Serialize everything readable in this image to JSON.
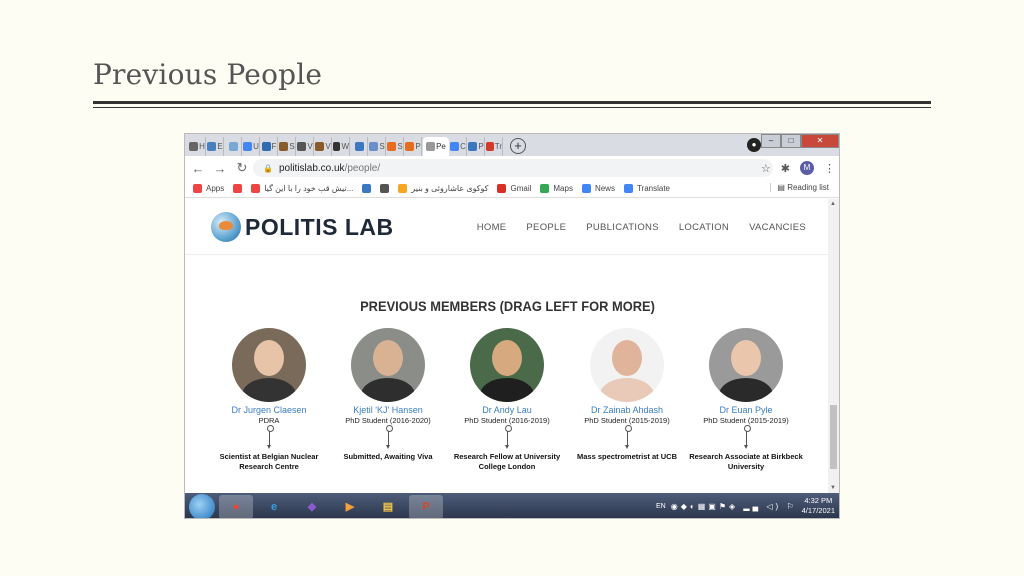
{
  "slide": {
    "title": "Previous People"
  },
  "browser": {
    "tabs": [
      {
        "label": "H",
        "color": "#666"
      },
      {
        "label": "E",
        "color": "#4a7fbf"
      },
      {
        "label": "",
        "color": "#7aa7d6"
      },
      {
        "label": "U",
        "color": "#4285f4"
      },
      {
        "label": "F",
        "color": "#2d6bb3"
      },
      {
        "label": "S",
        "color": "#8a5a2b"
      },
      {
        "label": "V",
        "color": "#555"
      },
      {
        "label": "V",
        "color": "#8a5a2b"
      },
      {
        "label": "W",
        "color": "#333"
      },
      {
        "label": "",
        "color": "#3b78c2"
      },
      {
        "label": "S",
        "color": "#6a8fc9"
      },
      {
        "label": "S",
        "color": "#e66c1f"
      },
      {
        "label": "P",
        "color": "#e66c1f"
      },
      {
        "label": "Pe",
        "color": "#999",
        "active": true
      },
      {
        "label": "C",
        "color": "#4285f4"
      },
      {
        "label": "P",
        "color": "#3b78c2"
      },
      {
        "label": "Tr",
        "color": "#d23a2a"
      }
    ],
    "new_tab": "+",
    "window_controls": {
      "minimize": "–",
      "maximize": "□",
      "close": "✕"
    },
    "url_host": "politislab.co.uk",
    "url_path": "/people/",
    "profile_initial": "M",
    "bookmarks": [
      {
        "label": "Apps",
        "color": "#e44"
      },
      {
        "label": "",
        "color": "#e44"
      },
      {
        "label": "تیش قب خود را با این گیا...",
        "color": "#e44"
      },
      {
        "label": "",
        "color": "#3b78c2"
      },
      {
        "label": "",
        "color": "#555"
      },
      {
        "label": "کوکوی عاشاروئی و بنیر",
        "color": "#f5a623"
      },
      {
        "label": "Gmail",
        "color": "#d93025"
      },
      {
        "label": "Maps",
        "color": "#34a853"
      },
      {
        "label": "News",
        "color": "#4285f4"
      },
      {
        "label": "Translate",
        "color": "#4285f4"
      }
    ],
    "reading_list": "Reading list"
  },
  "site": {
    "logo": "POLITIS LAB",
    "nav": [
      "HOME",
      "PEOPLE",
      "PUBLICATIONS",
      "LOCATION",
      "VACANCIES"
    ],
    "section_title": "PREVIOUS MEMBERS (DRAG LEFT FOR MORE)",
    "people": [
      {
        "name": "Dr Jurgen Claesen",
        "role": "PDRA",
        "destination": "Scientist at Belgian Nuclear Research Centre",
        "bg": "#7a6a5a",
        "skin": "#e7c4a8",
        "shirt": "#333"
      },
      {
        "name": "Kjetil 'KJ' Hansen",
        "role": "PhD Student (2016-2020)",
        "destination": "Submitted, Awaiting Viva",
        "bg": "#8a8d88",
        "skin": "#d9b293",
        "shirt": "#2e2e2e"
      },
      {
        "name": "Dr Andy Lau",
        "role": "PhD Student (2016-2019)",
        "destination": "Research Fellow at University College London",
        "bg": "#4a6a4a",
        "skin": "#d7a97f",
        "shirt": "#1f1f1f"
      },
      {
        "name": "Dr Zainab Ahdash",
        "role": "PhD Student (2015-2019)",
        "destination": "Mass spectrometrist at UCB",
        "bg": "#f2f2f2",
        "skin": "#e0b49a",
        "shirt": "#e9c9b8"
      },
      {
        "name": "Dr Euan Pyle",
        "role": "PhD Student (2015-2019)",
        "destination": "Research Associate at Birkbeck University",
        "bg": "#9a9a9a",
        "skin": "#eac6ad",
        "shirt": "#2a2a2a"
      }
    ]
  },
  "taskbar": {
    "apps": [
      {
        "name": "chrome",
        "glyph": "●",
        "color": "#e8453c"
      },
      {
        "name": "ie",
        "glyph": "e",
        "color": "#3b9be0"
      },
      {
        "name": "visual-studio",
        "glyph": "◆",
        "color": "#8a5bd0"
      },
      {
        "name": "media",
        "glyph": "▶",
        "color": "#f2a23a"
      },
      {
        "name": "folder",
        "glyph": "▤",
        "color": "#f0c84a"
      },
      {
        "name": "powerpoint",
        "glyph": "P",
        "color": "#d24726"
      }
    ],
    "language": "EN",
    "time": "4:32 PM",
    "date": "4/17/2021"
  }
}
